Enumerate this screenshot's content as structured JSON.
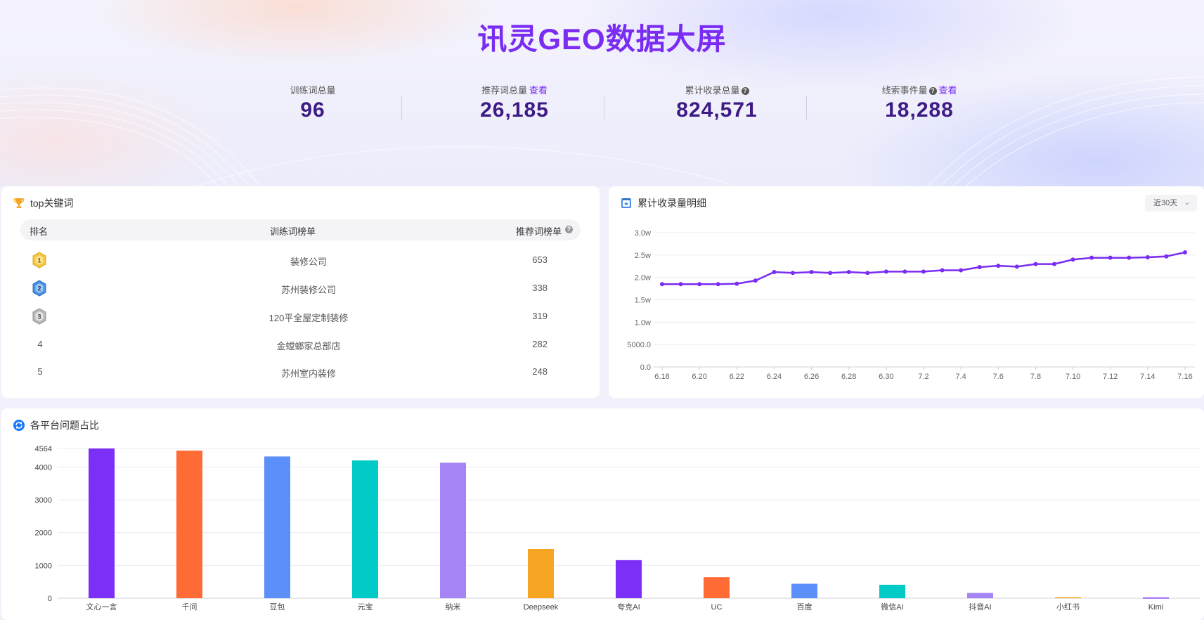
{
  "header": {
    "title": "讯灵GEO数据大屏"
  },
  "stats": [
    {
      "label": "训练词总量",
      "value": "96",
      "link": "",
      "help": false
    },
    {
      "label": "推荐词总量",
      "value": "26,185",
      "link": "查看",
      "help": false
    },
    {
      "label": "累计收录总量",
      "value": "824,571",
      "link": "",
      "help": true
    },
    {
      "label": "线索事件量",
      "value": "18,288",
      "link": "查看",
      "help": true
    }
  ],
  "top_keywords": {
    "title": "top关键词",
    "columns": [
      "排名",
      "训练词榜单",
      "推荐词榜单"
    ],
    "rows": [
      {
        "rank": "1",
        "keyword": "装修公司",
        "count": "653"
      },
      {
        "rank": "2",
        "keyword": "苏州装修公司",
        "count": "338"
      },
      {
        "rank": "3",
        "keyword": "120平全屋定制装修",
        "count": "319"
      },
      {
        "rank": "4",
        "keyword": "金螳螂家总部店",
        "count": "282"
      },
      {
        "rank": "5",
        "keyword": "苏州室内装修",
        "count": "248"
      }
    ]
  },
  "trend_panel": {
    "title": "累计收录量明细",
    "range_select": "近30天",
    "icons": {
      "title": "calendar-chart-icon",
      "dropdown": "chevron-down-icon"
    }
  },
  "bar_panel": {
    "title": "各平台问题占比"
  },
  "colors": {
    "accent": "#7a2cf2",
    "value": "#3d1a84",
    "line": "#7a2cf2"
  },
  "chart_data": [
    {
      "type": "line",
      "title": "累计收录量明细",
      "x": [
        "6.18",
        "6.19",
        "6.20",
        "6.21",
        "6.22",
        "6.23",
        "6.24",
        "6.25",
        "6.26",
        "6.27",
        "6.28",
        "6.29",
        "6.30",
        "7.1",
        "7.2",
        "7.3",
        "7.4",
        "7.5",
        "7.6",
        "7.7",
        "7.8",
        "7.9",
        "7.10",
        "7.11",
        "7.12",
        "7.13",
        "7.14",
        "7.15",
        "7.16"
      ],
      "x_tick_labels": [
        "6.18",
        "6.20",
        "6.22",
        "6.24",
        "6.26",
        "6.28",
        "6.30",
        "7.2",
        "7.4",
        "7.6",
        "7.8",
        "7.10",
        "7.12",
        "7.14",
        "7.16"
      ],
      "y_tick_labels": [
        "0.0",
        "5000.0",
        "1.0w",
        "1.5w",
        "2.0w",
        "2.5w",
        "3.0w"
      ],
      "ylim": [
        0,
        30000
      ],
      "series": [
        {
          "values": [
            18500,
            18500,
            18500,
            18500,
            18600,
            19300,
            21200,
            21000,
            21200,
            21000,
            21200,
            21000,
            21300,
            21300,
            21300,
            21600,
            21600,
            22300,
            22600,
            22400,
            23000,
            23000,
            24000,
            24400,
            24400,
            24400,
            24500,
            24700,
            25600,
            26200
          ]
        }
      ],
      "grid": true
    },
    {
      "type": "bar",
      "title": "各平台问题占比",
      "categories": [
        "文心一言",
        "千问",
        "豆包",
        "元宝",
        "纳米",
        "Deepseek",
        "夸克AI",
        "UC",
        "百度",
        "微信AI",
        "抖音AI",
        "小红书",
        "Kimi"
      ],
      "values": [
        4564,
        4500,
        4320,
        4200,
        4130,
        1500,
        1160,
        640,
        440,
        410,
        160,
        30,
        20
      ],
      "colors": [
        "#7b2ff7",
        "#ff6b35",
        "#5b8ff9",
        "#00cbc6",
        "#a584f5",
        "#f6a623",
        "#7b2ff7",
        "#ff6b35",
        "#5b8ff9",
        "#00cbc6",
        "#a584f5",
        "#f6a623",
        "#7b2ff7"
      ],
      "y_tick_labels": [
        "0",
        "1000",
        "2000",
        "3000",
        "4000",
        "4564"
      ],
      "ylim": [
        0,
        4564
      ],
      "grid": true
    }
  ]
}
